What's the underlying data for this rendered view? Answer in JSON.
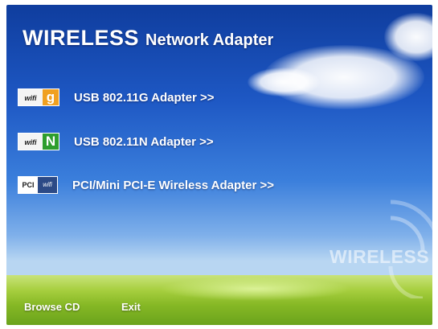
{
  "header": {
    "title_main": "WIRELESS",
    "title_sub": "Network Adapter"
  },
  "menu": {
    "items": [
      {
        "label": "USB 802.11G Adapter >>",
        "badge_text": "wifi",
        "badge_letter": "g",
        "badge_color": "#f0a020"
      },
      {
        "label": "USB 802.11N Adapter >>",
        "badge_text": "wifi",
        "badge_letter": "N",
        "badge_color": "#2e9e2e"
      },
      {
        "label": "PCI/Mini PCI-E Wireless Adapter >>",
        "badge_text": "PCI",
        "badge_sub": "wifi"
      }
    ]
  },
  "watermark": {
    "text": "WIRELESS"
  },
  "footer": {
    "browse_label": "Browse CD",
    "exit_label": "Exit"
  },
  "colors": {
    "sky_top": "#0f3d9e",
    "sky_bottom": "#b8d6f2",
    "grass": "#86b825",
    "text": "#ffffff"
  }
}
